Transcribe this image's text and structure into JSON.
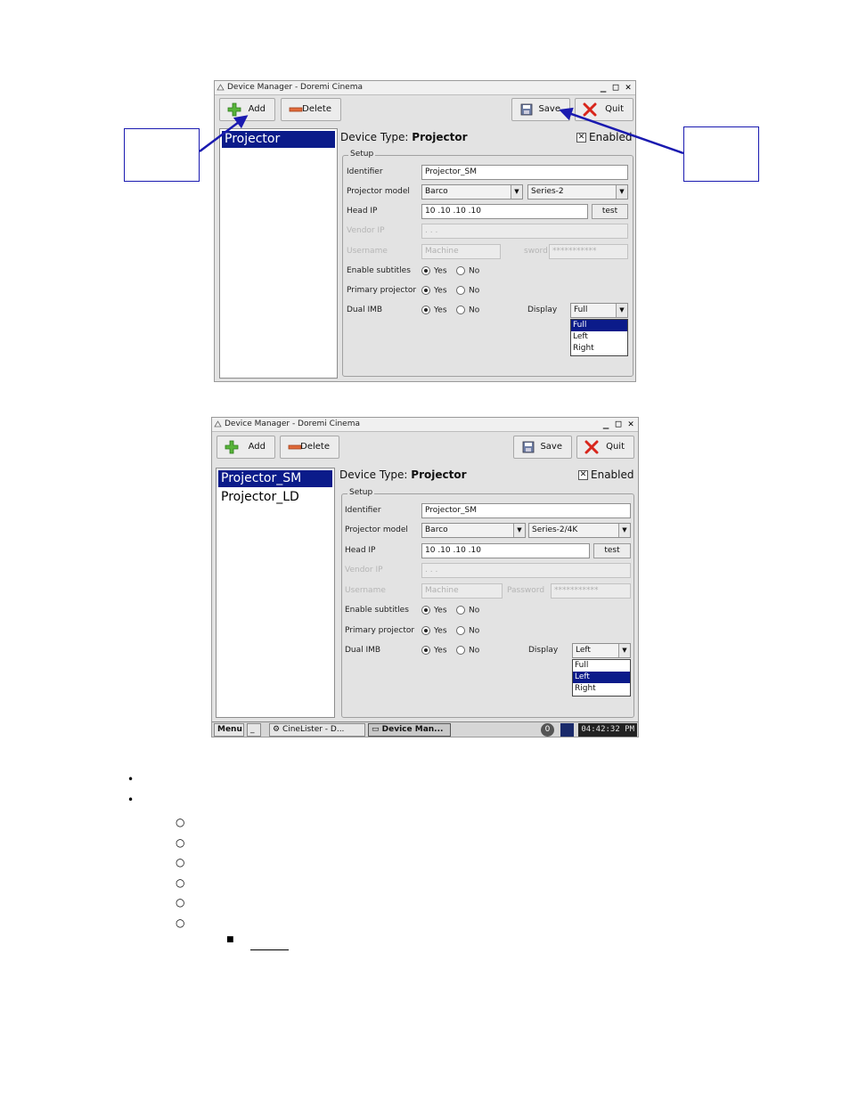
{
  "screens": [
    {
      "title": "Device Manager - Doremi Cinema",
      "toolbar": {
        "add": "Add",
        "delete": "Delete",
        "save": "Save",
        "quit": "Quit"
      },
      "device_list": [
        "Projector"
      ],
      "device_type_label": "Device Type: ",
      "device_type_value": "Projector",
      "enabled_label": "Enabled",
      "enabled": true,
      "setup_label": "Setup",
      "identifier_label": "Identifier",
      "identifier_value": "Projector_SM",
      "model_label": "Projector model",
      "model_make": "Barco",
      "model_series": "Series-2",
      "headip_label": "Head IP",
      "headip_value": "10 .10 .10 .10",
      "test_label": "test",
      "vendorip_label": "Vendor IP",
      "vendorip_value": ". . .",
      "username_label": "Username",
      "username_value": "Machine",
      "password_label": "sword",
      "password_value": "***********",
      "subtitles_label": "Enable subtitles",
      "primary_label": "Primary projector",
      "dualimb_label": "Dual IMB",
      "yes": "Yes",
      "no": "No",
      "display_label": "Display",
      "display_value": "Full",
      "display_options": [
        "Full",
        "Left",
        "Right"
      ],
      "display_selected_index": 0
    },
    {
      "title": "Device Manager - Doremi Cinema",
      "toolbar": {
        "add": "Add",
        "delete": "Delete",
        "save": "Save",
        "quit": "Quit"
      },
      "device_list": [
        "Projector_SM",
        "Projector_LD"
      ],
      "device_type_label": "Device Type: ",
      "device_type_value": "Projector",
      "enabled_label": "Enabled",
      "enabled": true,
      "setup_label": "Setup",
      "identifier_label": "Identifier",
      "identifier_value": "Projector_SM",
      "model_label": "Projector model",
      "model_make": "Barco",
      "model_series": "Series-2/4K",
      "headip_label": "Head IP",
      "headip_value": "10 .10 .10 .10",
      "test_label": "test",
      "vendorip_label": "Vendor IP",
      "vendorip_value": ". . .",
      "username_label": "Username",
      "username_value": "Machine",
      "password_label": "Password",
      "password_value": "***********",
      "subtitles_label": "Enable subtitles",
      "primary_label": "Primary projector",
      "dualimb_label": "Dual IMB",
      "yes": "Yes",
      "no": "No",
      "display_label": "Display",
      "display_value": "Left",
      "display_options": [
        "Full",
        "Left",
        "Right"
      ],
      "display_selected_index": 1
    }
  ],
  "taskbar": {
    "menu": "Menu",
    "items": [
      "CineLister - D...",
      "Device Man..."
    ],
    "tray_badge": "0",
    "clock": "04:42:32 PM"
  },
  "colors": {
    "selection": "#0b1b8a",
    "arrow": "#1a1ab0"
  }
}
